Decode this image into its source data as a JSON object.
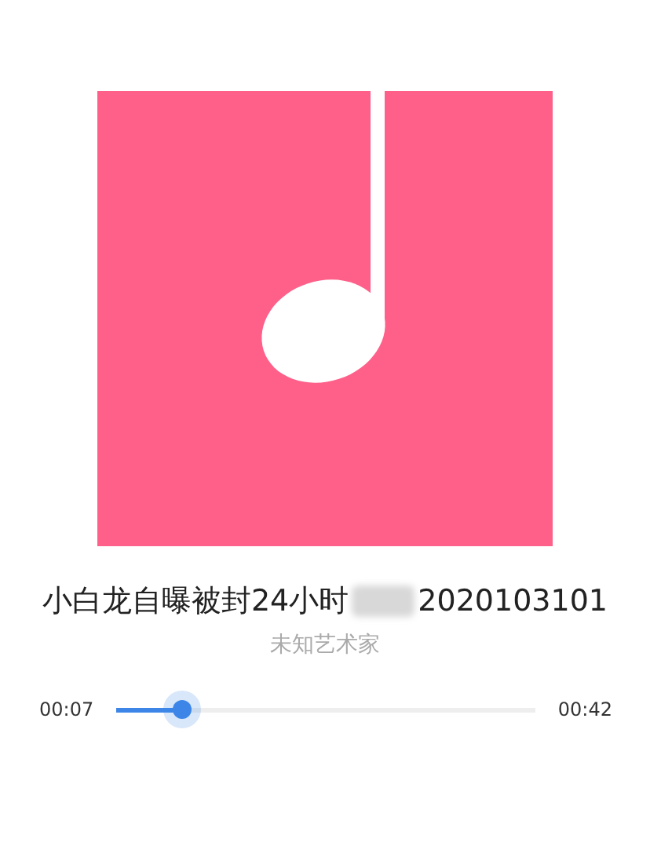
{
  "track": {
    "title_before": "小白龙自曝被封24小时",
    "title_after": "2020103101",
    "title_redacted": true,
    "artist": "未知艺术家"
  },
  "progress": {
    "elapsed": "00:07",
    "level": 0.16,
    "duration": "00:42"
  }
}
